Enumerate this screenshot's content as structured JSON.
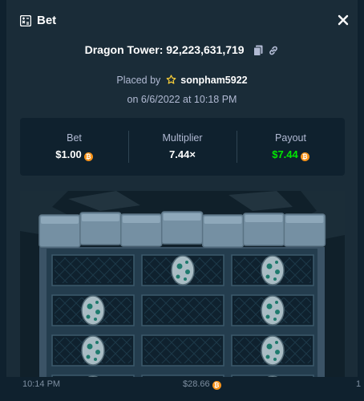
{
  "header": {
    "title": "Bet",
    "title_icon": "bet-slip-icon",
    "close_icon": "close-icon"
  },
  "game_title": "Dragon Tower: 92,223,631,719",
  "placed": {
    "prefix": "Placed by",
    "user": "sonpham5922",
    "date": "on 6/6/2022 at 10:18 PM"
  },
  "stats": {
    "bet": {
      "label": "Bet",
      "value": "$1.00"
    },
    "multiplier": {
      "label": "Multiplier",
      "value": "7.44×"
    },
    "payout": {
      "label": "Payout",
      "value": "$7.44"
    }
  },
  "coin_glyph": "₿",
  "grid": {
    "rows": [
      [
        false,
        true,
        true
      ],
      [
        true,
        false,
        true
      ],
      [
        true,
        false,
        true
      ],
      [
        true,
        false,
        true
      ]
    ]
  },
  "footer": {
    "time_left": "10:14 PM",
    "amount": "$28.66",
    "time_right": "1"
  },
  "colors": {
    "background": "#1a2c38",
    "panel": "#0f212e",
    "accent_green": "#00e701",
    "coin": "#f7931a",
    "muted": "#b1bad3"
  }
}
